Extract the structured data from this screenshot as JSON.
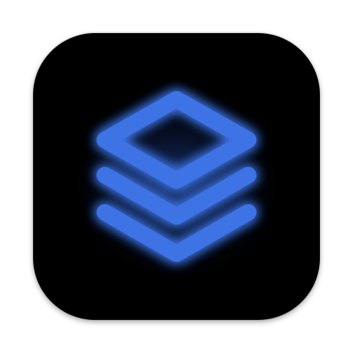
{
  "icon": {
    "name": "stacked-layers-icon",
    "background_color": "#000000",
    "glyph_color": "#3D73E4",
    "glow_color": "#2D5BC0"
  }
}
